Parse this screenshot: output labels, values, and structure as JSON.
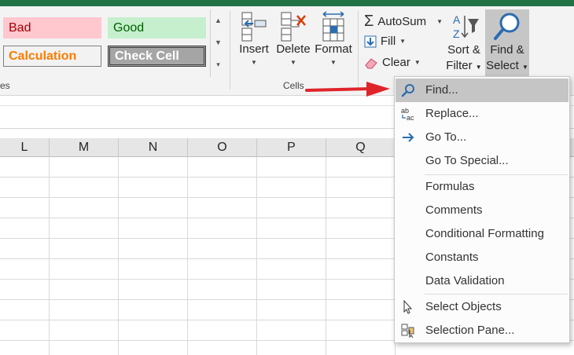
{
  "ribbon": {
    "styles": {
      "bad": "Bad",
      "good": "Good",
      "calculation": "Calculation",
      "check_cell": "Check Cell",
      "group_label_partial": "es"
    },
    "cells": {
      "insert": "Insert",
      "delete": "Delete",
      "format": "Format",
      "group_label": "Cells"
    },
    "editing": {
      "autosum": "AutoSum",
      "fill": "Fill",
      "clear": "Clear",
      "sort_filter_1": "Sort &",
      "sort_filter_2": "Filter",
      "find_select_1": "Find &",
      "find_select_2": "Select"
    }
  },
  "grid": {
    "columns": [
      "L",
      "M",
      "N",
      "O",
      "P",
      "Q"
    ]
  },
  "menu": {
    "items": [
      {
        "label": "Find...",
        "icon": "magnifier-icon",
        "highlighted": true
      },
      {
        "label": "Replace...",
        "icon": "replace-icon"
      },
      {
        "label": "Go To...",
        "icon": "arrow-right-icon"
      },
      {
        "label": "Go To Special...",
        "icon": ""
      },
      {
        "label": "Formulas",
        "icon": ""
      },
      {
        "label": "Comments",
        "icon": ""
      },
      {
        "label": "Conditional Formatting",
        "icon": ""
      },
      {
        "label": "Constants",
        "icon": ""
      },
      {
        "label": "Data Validation",
        "icon": ""
      },
      {
        "label": "Select Objects",
        "icon": "pointer-icon"
      },
      {
        "label": "Selection Pane...",
        "icon": "selection-pane-icon"
      }
    ]
  },
  "colors": {
    "excel_green": "#217346",
    "annotation_arrow": "#e0242b",
    "find_icon": "#2b6cb0"
  }
}
